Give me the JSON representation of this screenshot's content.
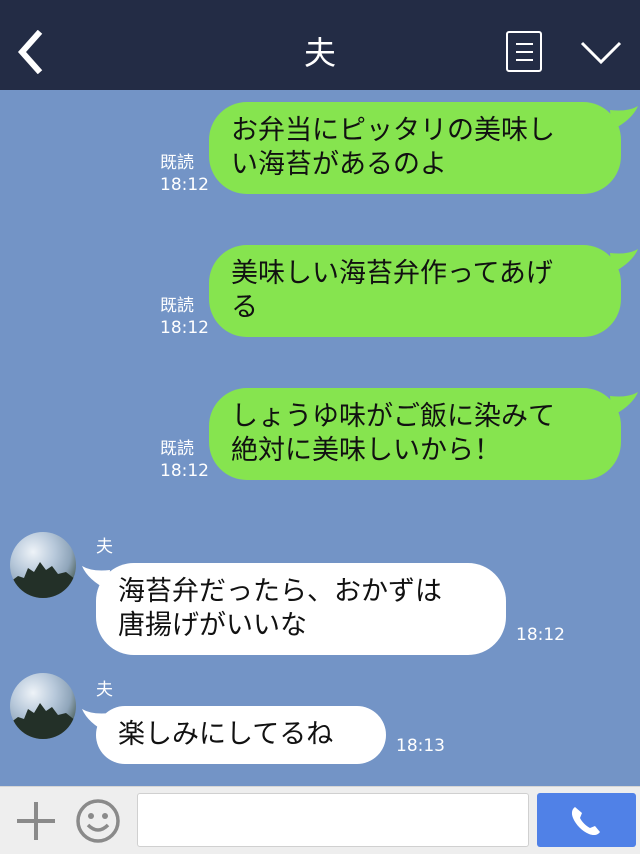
{
  "header": {
    "title": "夫",
    "back_icon": "chevron-left-icon",
    "menu_icon": "list-icon",
    "collapse_icon": "chevron-down-icon"
  },
  "messages_out": [
    {
      "text_line1": "お弁当にピッタリの美味し",
      "text_line2": "い海苔があるのよ",
      "read": "既読",
      "time": "18:12"
    },
    {
      "text_line1": "美味しい海苔弁作ってあげ",
      "text_line2": "る",
      "read": "既読",
      "time": "18:12"
    },
    {
      "text_line1": "しょうゆ味がご飯に染みて",
      "text_line2": "絶対に美味しいから！",
      "read": "既読",
      "time": "18:12"
    }
  ],
  "messages_in": [
    {
      "sender": "夫",
      "text_line1": "海苔弁だったら、おかずは",
      "text_line2": "唐揚げがいいな",
      "time": "18:12"
    },
    {
      "sender": "夫",
      "text_line1": "楽しみにしてるね",
      "text_line2": "",
      "time": "18:13"
    }
  ],
  "footer": {
    "input_placeholder": "",
    "plus_icon": "plus-icon",
    "emoji_icon": "smiley-icon",
    "call_icon": "phone-icon"
  },
  "colors": {
    "header": "#232c45",
    "background": "#7394c6",
    "outgoing": "#86e44f",
    "incoming": "#ffffff",
    "call_button": "#5081e7"
  }
}
